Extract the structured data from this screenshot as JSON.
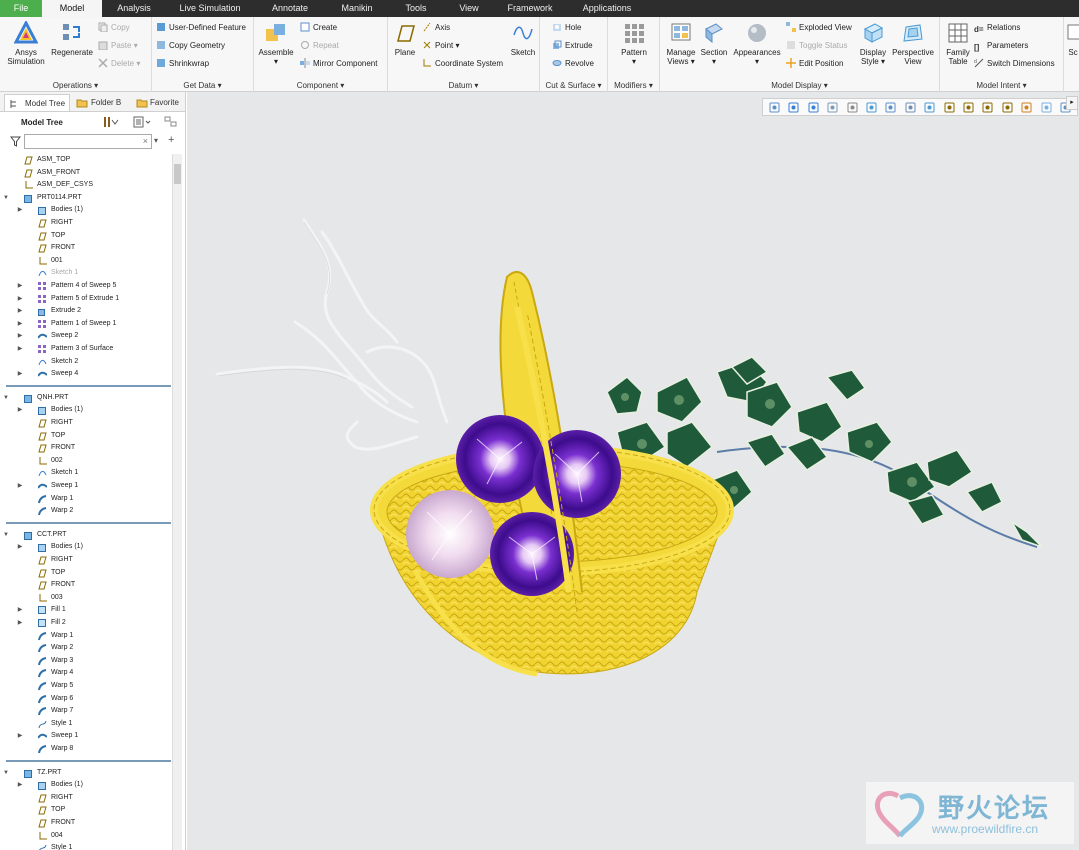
{
  "menu": {
    "items": [
      "File",
      "Model",
      "Analysis",
      "Live Simulation",
      "Annotate",
      "Manikin",
      "Tools",
      "View",
      "Framework",
      "Applications"
    ],
    "active": "Model"
  },
  "ribbon": {
    "operations": {
      "label": "Operations",
      "ansys": "Ansys\nSimulation",
      "ansys_l1": "Ansys",
      "ansys_l2": "Simulation",
      "regenerate": "Regenerate",
      "copy": "Copy",
      "paste": "Paste",
      "delete": "Delete"
    },
    "get_data": {
      "label": "Get Data",
      "udf": "User-Defined Feature",
      "copy_geometry": "Copy Geometry",
      "shrinkwrap": "Shrinkwrap"
    },
    "component": {
      "label": "Component",
      "assemble": "Assemble",
      "create": "Create",
      "repeat": "Repeat",
      "mirror": "Mirror Component"
    },
    "datum": {
      "label": "Datum",
      "plane": "Plane",
      "axis": "Axis",
      "point": "Point",
      "csys": "Coordinate System",
      "sketch": "Sketch"
    },
    "cut_surface": {
      "label": "Cut & Surface",
      "hole": "Hole",
      "extrude": "Extrude",
      "revolve": "Revolve"
    },
    "modifiers": {
      "label": "Modifiers",
      "pattern": "Pattern"
    },
    "model_display": {
      "label": "Model Display",
      "manage_views_1": "Manage",
      "manage_views_2": "Views",
      "section": "Section",
      "appearances": "Appearances",
      "exploded": "Exploded View",
      "toggle_status": "Toggle Status",
      "edit_position": "Edit Position",
      "display_style_1": "Display",
      "display_style_2": "Style",
      "perspective_1": "Perspective",
      "perspective_2": "View"
    },
    "model_intent": {
      "label": "Model Intent",
      "family_1": "Family",
      "family_2": "Table",
      "relations": "Relations",
      "parameters": "Parameters",
      "switch_dims": "Switch Dimensions",
      "sc": "Sc"
    }
  },
  "left_panel": {
    "tabs": [
      "Model Tree",
      "Folder B",
      "Favorite"
    ],
    "tree_title": "Model Tree",
    "filter_placeholder": "",
    "rows": [
      {
        "label": "ASM_TOP",
        "indent": 0,
        "icon": "plane",
        "toggle": ""
      },
      {
        "label": "ASM_FRONT",
        "indent": 0,
        "icon": "plane",
        "toggle": ""
      },
      {
        "label": "ASM_DEF_CSYS",
        "indent": 0,
        "icon": "csys",
        "toggle": ""
      },
      {
        "label": "PRT0114.PRT",
        "indent": 0,
        "icon": "part",
        "toggle": "▼"
      },
      {
        "label": "Bodies (1)",
        "indent": 1,
        "icon": "bodies",
        "toggle": "▶"
      },
      {
        "label": "RIGHT",
        "indent": 1,
        "icon": "plane",
        "toggle": ""
      },
      {
        "label": "TOP",
        "indent": 1,
        "icon": "plane",
        "toggle": ""
      },
      {
        "label": "FRONT",
        "indent": 1,
        "icon": "plane",
        "toggle": ""
      },
      {
        "label": "001",
        "indent": 1,
        "icon": "csys",
        "toggle": ""
      },
      {
        "label": "Sketch 1",
        "indent": 1,
        "icon": "sketch",
        "toggle": "",
        "dim": true
      },
      {
        "label": "Pattern 4 of Sweep 5",
        "indent": 1,
        "icon": "pattern",
        "toggle": "▶"
      },
      {
        "label": "Pattern 5 of Extrude 1",
        "indent": 1,
        "icon": "pattern",
        "toggle": "▶"
      },
      {
        "label": "Extrude 2",
        "indent": 1,
        "icon": "extrude",
        "toggle": "▶"
      },
      {
        "label": "Pattern 1 of Sweep 1",
        "indent": 1,
        "icon": "pattern",
        "toggle": "▶"
      },
      {
        "label": "Sweep 2",
        "indent": 1,
        "icon": "sweep",
        "toggle": "▶"
      },
      {
        "label": "Pattern 3 of Surface",
        "indent": 1,
        "icon": "pattern",
        "toggle": "▶"
      },
      {
        "label": "Sketch 2",
        "indent": 1,
        "icon": "sketch",
        "toggle": ""
      },
      {
        "label": "Sweep 4",
        "indent": 1,
        "icon": "sweep",
        "toggle": "▶"
      },
      {
        "sep": true
      },
      {
        "label": "QNH.PRT",
        "indent": 0,
        "icon": "part",
        "toggle": "▼"
      },
      {
        "label": "Bodies (1)",
        "indent": 1,
        "icon": "bodies",
        "toggle": "▶"
      },
      {
        "label": "RIGHT",
        "indent": 1,
        "icon": "plane",
        "toggle": ""
      },
      {
        "label": "TOP",
        "indent": 1,
        "icon": "plane",
        "toggle": ""
      },
      {
        "label": "FRONT",
        "indent": 1,
        "icon": "plane",
        "toggle": ""
      },
      {
        "label": "002",
        "indent": 1,
        "icon": "csys",
        "toggle": ""
      },
      {
        "label": "Sketch 1",
        "indent": 1,
        "icon": "sketch",
        "toggle": ""
      },
      {
        "label": "Sweep 1",
        "indent": 1,
        "icon": "sweep",
        "toggle": "▶"
      },
      {
        "label": "Warp 1",
        "indent": 1,
        "icon": "warp",
        "toggle": ""
      },
      {
        "label": "Warp 2",
        "indent": 1,
        "icon": "warp",
        "toggle": ""
      },
      {
        "sep": true
      },
      {
        "label": "CCT.PRT",
        "indent": 0,
        "icon": "part",
        "toggle": "▼"
      },
      {
        "label": "Bodies (1)",
        "indent": 1,
        "icon": "bodies",
        "toggle": "▶"
      },
      {
        "label": "RIGHT",
        "indent": 1,
        "icon": "plane",
        "toggle": ""
      },
      {
        "label": "TOP",
        "indent": 1,
        "icon": "plane",
        "toggle": ""
      },
      {
        "label": "FRONT",
        "indent": 1,
        "icon": "plane",
        "toggle": ""
      },
      {
        "label": "003",
        "indent": 1,
        "icon": "csys",
        "toggle": ""
      },
      {
        "label": "Fill 1",
        "indent": 1,
        "icon": "fill",
        "toggle": "▶"
      },
      {
        "label": "Fill 2",
        "indent": 1,
        "icon": "fill",
        "toggle": "▶"
      },
      {
        "label": "Warp 1",
        "indent": 1,
        "icon": "warp",
        "toggle": ""
      },
      {
        "label": "Warp 2",
        "indent": 1,
        "icon": "warp",
        "toggle": ""
      },
      {
        "label": "Warp 3",
        "indent": 1,
        "icon": "warp",
        "toggle": ""
      },
      {
        "label": "Warp 4",
        "indent": 1,
        "icon": "warp",
        "toggle": ""
      },
      {
        "label": "Warp 5",
        "indent": 1,
        "icon": "warp",
        "toggle": ""
      },
      {
        "label": "Warp 6",
        "indent": 1,
        "icon": "warp",
        "toggle": ""
      },
      {
        "label": "Warp 7",
        "indent": 1,
        "icon": "warp",
        "toggle": ""
      },
      {
        "label": "Style 1",
        "indent": 1,
        "icon": "style",
        "toggle": ""
      },
      {
        "label": "Sweep 1",
        "indent": 1,
        "icon": "sweep",
        "toggle": "▶"
      },
      {
        "label": "Warp 8",
        "indent": 1,
        "icon": "warp",
        "toggle": ""
      },
      {
        "sep": true
      },
      {
        "label": "TZ.PRT",
        "indent": 0,
        "icon": "part",
        "toggle": "▼"
      },
      {
        "label": "Bodies (1)",
        "indent": 1,
        "icon": "bodies",
        "toggle": "▶"
      },
      {
        "label": "RIGHT",
        "indent": 1,
        "icon": "plane",
        "toggle": ""
      },
      {
        "label": "TOP",
        "indent": 1,
        "icon": "plane",
        "toggle": ""
      },
      {
        "label": "FRONT",
        "indent": 1,
        "icon": "plane",
        "toggle": ""
      },
      {
        "label": "004",
        "indent": 1,
        "icon": "csys",
        "toggle": ""
      },
      {
        "label": "Style 1",
        "indent": 1,
        "icon": "style",
        "toggle": ""
      }
    ]
  },
  "view_toolbar": {
    "icons": [
      "refit-icon",
      "zoom-in-icon",
      "zoom-out-icon",
      "repaint-icon",
      "pan-icon",
      "display-style-icon",
      "saved-views-icon",
      "view-manager-icon",
      "spin-center-icon",
      "plane-display-icon",
      "axis-display-icon",
      "point-display-icon",
      "csys-display-icon",
      "annotation-display-icon",
      "appearance-icon",
      "section-icon"
    ]
  },
  "watermark": {
    "cn": "野火论坛",
    "url": "www.proewildfire.cn"
  },
  "colors": {
    "basket": "#f2d531",
    "basket_dark": "#c9a812",
    "flower_purple": "#5a1fa8",
    "ivy_green": "#1f5a3a",
    "file_green": "#4cae4c",
    "menubar": "#2d2d2d",
    "viewport_bg": "#e6e7e9"
  }
}
